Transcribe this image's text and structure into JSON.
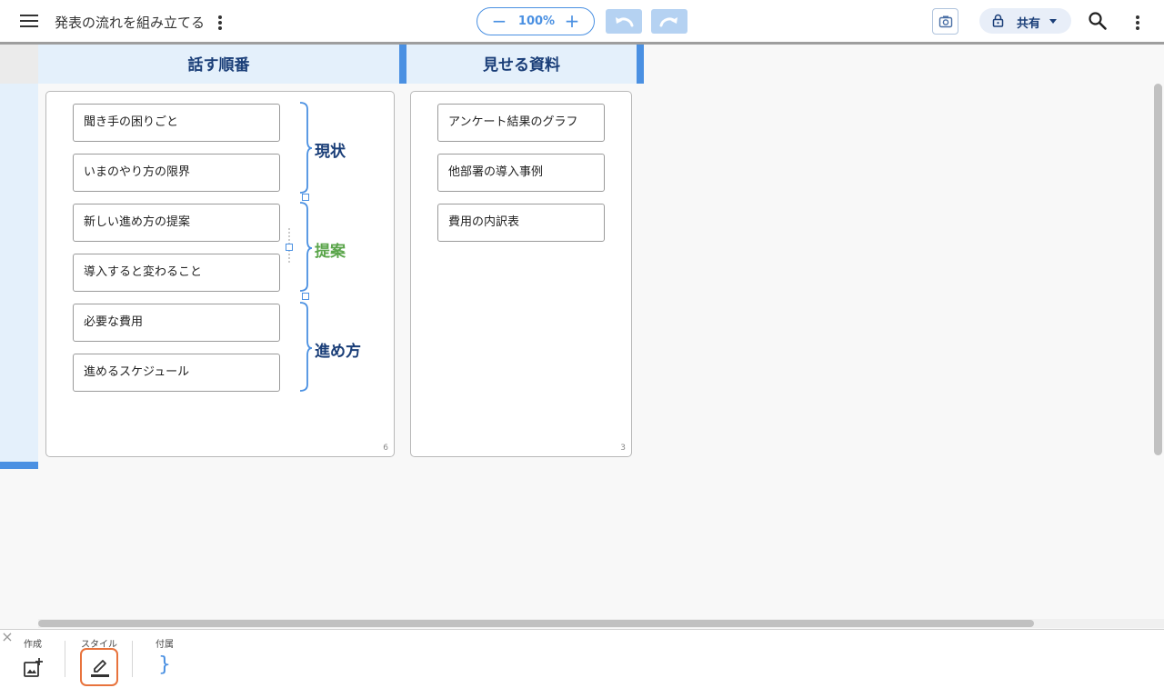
{
  "header": {
    "title": "発表の流れを組み立てる",
    "zoom": "100%",
    "zoom_out_label": "−",
    "zoom_in_label": "+",
    "share_label": "共有"
  },
  "columns": [
    {
      "title": "話す順番",
      "count": "6"
    },
    {
      "title": "見せる資料",
      "count": "3"
    }
  ],
  "order_cards": [
    "聞き手の困りごと",
    "いまのやり方の限界",
    "新しい進め方の提案",
    "導入すると変わること",
    "必要な費用",
    "進めるスケジュール"
  ],
  "material_cards": [
    "アンケート結果のグラフ",
    "他部署の導入事例",
    "費用の内訳表"
  ],
  "groups": [
    {
      "label": "現状",
      "color": "#1a3e78"
    },
    {
      "label": "提案",
      "color": "#5aa54a"
    },
    {
      "label": "進め方",
      "color": "#1a3e78"
    }
  ],
  "toolbar": {
    "create_label": "作成",
    "style_label": "スタイル",
    "attach_label": "付属",
    "attach_glyph": "}",
    "close_glyph": "×"
  },
  "colors": {
    "accent": "#4a90e2",
    "heading": "#1a3e78",
    "highlight": "#e8733c"
  },
  "icons": [
    "menu-icon",
    "more-vert-icon",
    "undo-icon",
    "redo-icon",
    "camera-icon",
    "lock-icon",
    "search-icon",
    "add-image-icon",
    "pen-icon",
    "brace-icon",
    "close-icon"
  ]
}
